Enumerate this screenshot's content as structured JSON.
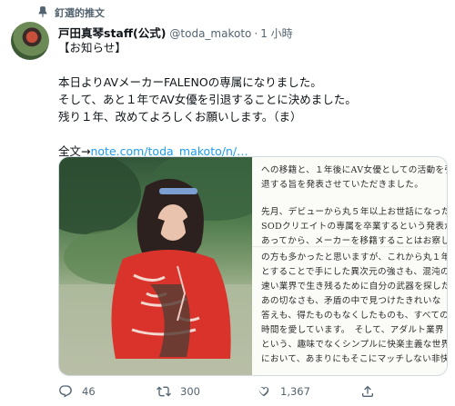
{
  "pinned": {
    "label": "釘選的推文"
  },
  "author": {
    "display_name": "戸田真琴staff(公式)",
    "handle": "@toda_makoto",
    "separator": "·",
    "timestamp": "1 小時"
  },
  "tweet": {
    "lines": [
      "【お知らせ】",
      "本日よりAVメーカーFALENOの専属になりました。",
      "そして、あと１年でAV女優を引退することに決めました。",
      "残り１年、改めてよろしくお願いします。（ま）"
    ],
    "link_prefix": "全文→",
    "link_text": "note.com/toda_makoto/n/…"
  },
  "media": {
    "document_lines": [
      "への移籍と、１年後にAV女優としての活動を引",
      "退する旨を発表させていただきました。",
      "",
      "先月、デビューから丸５年以上お世話になった",
      "SODクリエイトの専属を卒業するという発表が",
      "あってから、メーカーを移籍することはお察し",
      "の方も多かったと思いますが、これから丸１年",
      "とすることで手にした異次元の強さも、混沌の",
      "速い業界で生き残るために自分の武器を探した",
      "あの切なさも、矛盾の中で見つけたきれいな",
      "答えも、得たものもなくしたものも、すべての",
      "時間を愛しています。　そして、アダルト業界",
      "という、趣味でなくシンプルに快楽主義な世界",
      "において、あまりにもそこにマッチしない非快"
    ]
  },
  "actions": {
    "reply_count": "46",
    "retweet_count": "300",
    "like_count": "1,367"
  },
  "colors": {
    "accent_link": "#1d9bf0",
    "secondary_text": "#536471"
  }
}
